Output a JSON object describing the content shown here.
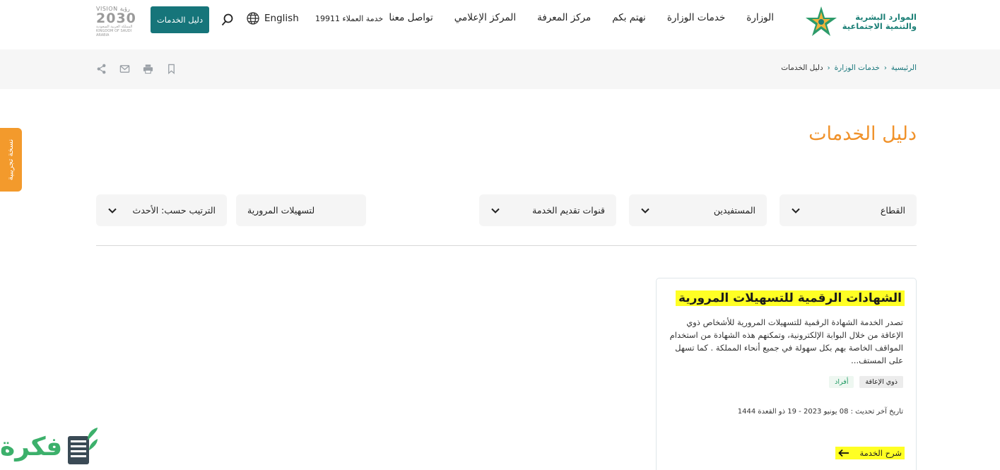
{
  "header": {
    "logo_line1": "الموارد البشرية",
    "logo_line2": "والتنمية الاجتماعية",
    "nav": [
      "الوزارة",
      "خدمات الوزارة",
      "نهتم بكم",
      "مركز المعرفة",
      "المركز الإعلامي",
      "تواصل معنا"
    ],
    "customer_service": "خدمة العملاء 19911",
    "language": "English",
    "guide_button": "دليل الخدمات",
    "vision_top": "VISION رؤية",
    "vision_year": "2030",
    "vision_bottom": "المملكة العربية السعودية KINGDOM OF SAUDI ARABIA"
  },
  "breadcrumb": [
    "الرئيسية",
    "خدمات الوزارة",
    "دليل الخدمات"
  ],
  "beta_tab": "نسخة تجريبية",
  "page_title": "دليل الخدمات",
  "filters": {
    "sector": "القطاع",
    "beneficiary": "المستفيدين",
    "channel": "قنوات تقديم الخدمة",
    "search_value": "لتسهيلات المرورية",
    "sort": "الترتيب حسب: الأحدث"
  },
  "card": {
    "title": "الشهادات الرقمية للتسهيلات المرورية",
    "description": "تصدر الخدمة الشهادة الرقمية للتسهيلات المرورية للأشخاص ذوي الإعاقة من خلال البوابة الإلكترونية، وتمكنهم هذه الشهادة من استخدام المواقف الخاصة بهم بكل سهولة في جميع أنحاء المملكة . كما تسهل على المستف...",
    "tags": [
      "ذوي الإعاقة",
      "أفراد"
    ],
    "updated": "تاريخ آخر تحديث : 08 يونيو 2023 - 19 ذو القعدة 1444",
    "link": "شرح الخدمة"
  },
  "watermark": "فكرة",
  "colors": {
    "accent_orange": "#f0922b",
    "brand_teal": "#16757a",
    "highlight": "#ffff24"
  }
}
